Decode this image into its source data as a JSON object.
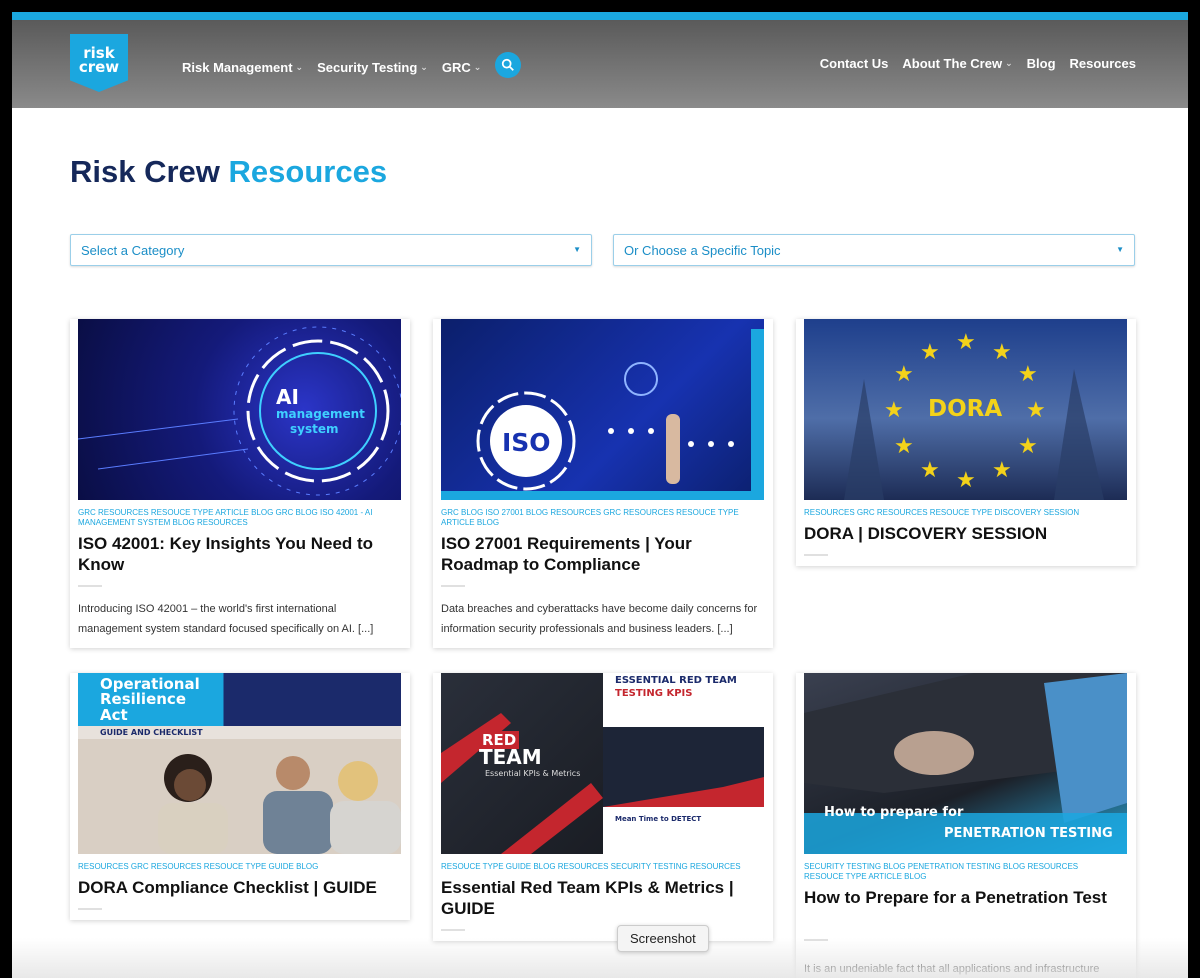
{
  "header": {
    "logo_text": "risk crew",
    "nav_left": [
      "Risk Management",
      "Security Testing",
      "GRC"
    ],
    "nav_right": [
      "Contact Us",
      "About The Crew",
      "Blog",
      "Resources"
    ],
    "accent": "#1ba7df"
  },
  "page": {
    "title_main": "Risk Crew",
    "title_accent": "Resources"
  },
  "filters": {
    "category": "Select a Category",
    "topic": "Or Choose a Specific Topic"
  },
  "cards": [
    {
      "meta": "GRC RESOURCES RESOUCE TYPE ARTICLE BLOG GRC BLOG ISO 42001 - AI MANAGEMENT SYSTEM BLOG RESOURCES",
      "title": "ISO 42001: Key Insights You Need to Know",
      "excerpt": "Introducing ISO 42001 – the world's first international management system standard focused specifically on AI. [...]",
      "image_text": [
        "AI",
        "management",
        "system"
      ]
    },
    {
      "meta": "GRC BLOG ISO 27001 BLOG RESOURCES GRC RESOURCES RESOUCE TYPE ARTICLE BLOG",
      "title": "ISO 27001 Requirements | Your Roadmap to Compliance",
      "excerpt": "Data breaches and cyberattacks have become daily concerns for information security professionals and business leaders. [...]",
      "image_text": [
        "ISO"
      ]
    },
    {
      "meta": "RESOURCES GRC RESOURCES RESOUCE TYPE DISCOVERY SESSION",
      "title": "DORA | DISCOVERY SESSION",
      "image_text": [
        "DORA"
      ]
    },
    {
      "meta": "RESOURCES GRC RESOURCES RESOUCE TYPE GUIDE BLOG",
      "title": "DORA Compliance Checklist | GUIDE",
      "image_text": [
        "Operational",
        "Resilience",
        "Act",
        "GUIDE AND CHECKLIST"
      ]
    },
    {
      "meta": "RESOUCE TYPE GUIDE BLOG RESOURCES SECURITY TESTING RESOURCES",
      "title": "Essential Red Team KPIs & Metrics | GUIDE",
      "image_text": [
        "RED",
        "TEAM",
        "Essential KPIs & Metrics",
        "ESSENTIAL RED TEAM",
        "TESTING KPIS",
        "Mean Time to DETECT"
      ]
    },
    {
      "meta": "SECURITY TESTING BLOG PENETRATION TESTING BLOG RESOURCES RESOUCE TYPE ARTICLE BLOG",
      "title": "How to Prepare for a Penetration Test",
      "excerpt": "It is an undeniable fact that all applications and infrastructure",
      "image_text": [
        "How to prepare for",
        "PENETRATION TESTING"
      ]
    }
  ],
  "tooltip": "Screenshot"
}
